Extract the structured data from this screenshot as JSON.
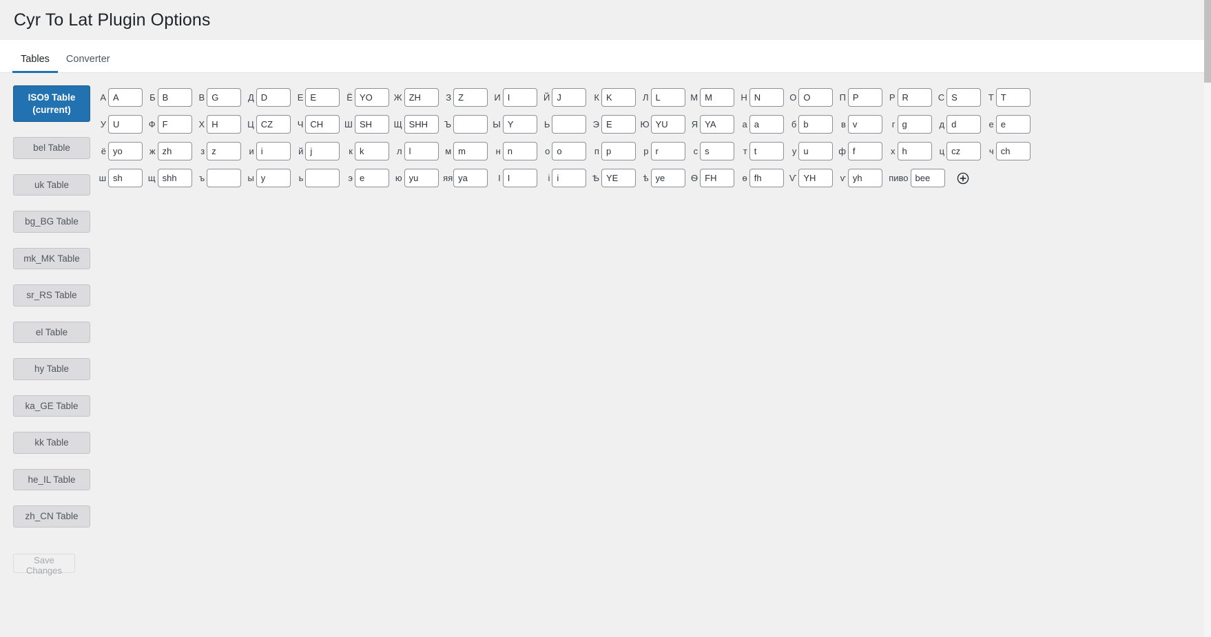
{
  "header": {
    "title": "Cyr To Lat Plugin Options"
  },
  "tabs": [
    {
      "label": "Tables",
      "active": true
    },
    {
      "label": "Converter",
      "active": false
    }
  ],
  "sidebar": {
    "buttons": [
      {
        "label": "ISO9 Table (current)",
        "current": true
      },
      {
        "label": "bel Table",
        "current": false
      },
      {
        "label": "uk Table",
        "current": false
      },
      {
        "label": "bg_BG Table",
        "current": false
      },
      {
        "label": "mk_MK Table",
        "current": false
      },
      {
        "label": "sr_RS Table",
        "current": false
      },
      {
        "label": "el Table",
        "current": false
      },
      {
        "label": "hy Table",
        "current": false
      },
      {
        "label": "ka_GE Table",
        "current": false
      },
      {
        "label": "kk Table",
        "current": false
      },
      {
        "label": "he_IL Table",
        "current": false
      },
      {
        "label": "zh_CN Table",
        "current": false
      }
    ],
    "save_label": "Save Changes"
  },
  "table": {
    "add_icon": "plus-circle-icon",
    "rows": [
      [
        {
          "cyr": "А",
          "lat": "A"
        },
        {
          "cyr": "Б",
          "lat": "B"
        },
        {
          "cyr": "В",
          "lat": "G"
        },
        {
          "cyr": "Д",
          "lat": "D"
        },
        {
          "cyr": "Е",
          "lat": "E"
        },
        {
          "cyr": "Ё",
          "lat": "YO"
        },
        {
          "cyr": "Ж",
          "lat": "ZH"
        },
        {
          "cyr": "З",
          "lat": "Z"
        },
        {
          "cyr": "И",
          "lat": "I"
        },
        {
          "cyr": "Й",
          "lat": "J"
        },
        {
          "cyr": "К",
          "lat": "K"
        },
        {
          "cyr": "Л",
          "lat": "L"
        },
        {
          "cyr": "М",
          "lat": "M"
        },
        {
          "cyr": "Н",
          "lat": "N"
        },
        {
          "cyr": "О",
          "lat": "O"
        },
        {
          "cyr": "П",
          "lat": "P"
        },
        {
          "cyr": "Р",
          "lat": "R"
        },
        {
          "cyr": "С",
          "lat": "S"
        },
        {
          "cyr": "Т",
          "lat": "T"
        }
      ],
      [
        {
          "cyr": "У",
          "lat": "U"
        },
        {
          "cyr": "Ф",
          "lat": "F"
        },
        {
          "cyr": "Х",
          "lat": "H"
        },
        {
          "cyr": "Ц",
          "lat": "CZ"
        },
        {
          "cyr": "Ч",
          "lat": "CH"
        },
        {
          "cyr": "Ш",
          "lat": "SH"
        },
        {
          "cyr": "Щ",
          "lat": "SHH"
        },
        {
          "cyr": "Ъ",
          "lat": ""
        },
        {
          "cyr": "Ы",
          "lat": "Y"
        },
        {
          "cyr": "Ь",
          "lat": ""
        },
        {
          "cyr": "Э",
          "lat": "E"
        },
        {
          "cyr": "Ю",
          "lat": "YU"
        },
        {
          "cyr": "Я",
          "lat": "YA"
        },
        {
          "cyr": "а",
          "lat": "a"
        },
        {
          "cyr": "б",
          "lat": "b"
        },
        {
          "cyr": "в",
          "lat": "v"
        },
        {
          "cyr": "г",
          "lat": "g"
        },
        {
          "cyr": "д",
          "lat": "d"
        },
        {
          "cyr": "е",
          "lat": "e"
        }
      ],
      [
        {
          "cyr": "ё",
          "lat": "yo"
        },
        {
          "cyr": "ж",
          "lat": "zh"
        },
        {
          "cyr": "з",
          "lat": "z"
        },
        {
          "cyr": "и",
          "lat": "i"
        },
        {
          "cyr": "й",
          "lat": "j"
        },
        {
          "cyr": "к",
          "lat": "k"
        },
        {
          "cyr": "л",
          "lat": "l"
        },
        {
          "cyr": "м",
          "lat": "m"
        },
        {
          "cyr": "н",
          "lat": "n"
        },
        {
          "cyr": "о",
          "lat": "o"
        },
        {
          "cyr": "п",
          "lat": "p"
        },
        {
          "cyr": "р",
          "lat": "r"
        },
        {
          "cyr": "с",
          "lat": "s"
        },
        {
          "cyr": "т",
          "lat": "t"
        },
        {
          "cyr": "у",
          "lat": "u"
        },
        {
          "cyr": "ф",
          "lat": "f"
        },
        {
          "cyr": "х",
          "lat": "h"
        },
        {
          "cyr": "ц",
          "lat": "cz"
        },
        {
          "cyr": "ч",
          "lat": "ch"
        }
      ],
      [
        {
          "cyr": "ш",
          "lat": "sh"
        },
        {
          "cyr": "щ",
          "lat": "shh"
        },
        {
          "cyr": "ъ",
          "lat": ""
        },
        {
          "cyr": "ы",
          "lat": "y"
        },
        {
          "cyr": "ь",
          "lat": ""
        },
        {
          "cyr": "э",
          "lat": "e"
        },
        {
          "cyr": "ю",
          "lat": "yu"
        },
        {
          "cyr": "яя",
          "lat": "ya"
        },
        {
          "cyr": "I",
          "lat": "I"
        },
        {
          "cyr": "i",
          "lat": "i"
        },
        {
          "cyr": "Ѣ",
          "lat": "YE"
        },
        {
          "cyr": "ѣ",
          "lat": "ye"
        },
        {
          "cyr": "Ѳ",
          "lat": "FH"
        },
        {
          "cyr": "ѳ",
          "lat": "fh"
        },
        {
          "cyr": "Ѵ",
          "lat": "YH"
        },
        {
          "cyr": "ѵ",
          "lat": "yh"
        },
        {
          "cyr": "пиво",
          "lat": "bee",
          "wide": true
        }
      ]
    ]
  }
}
